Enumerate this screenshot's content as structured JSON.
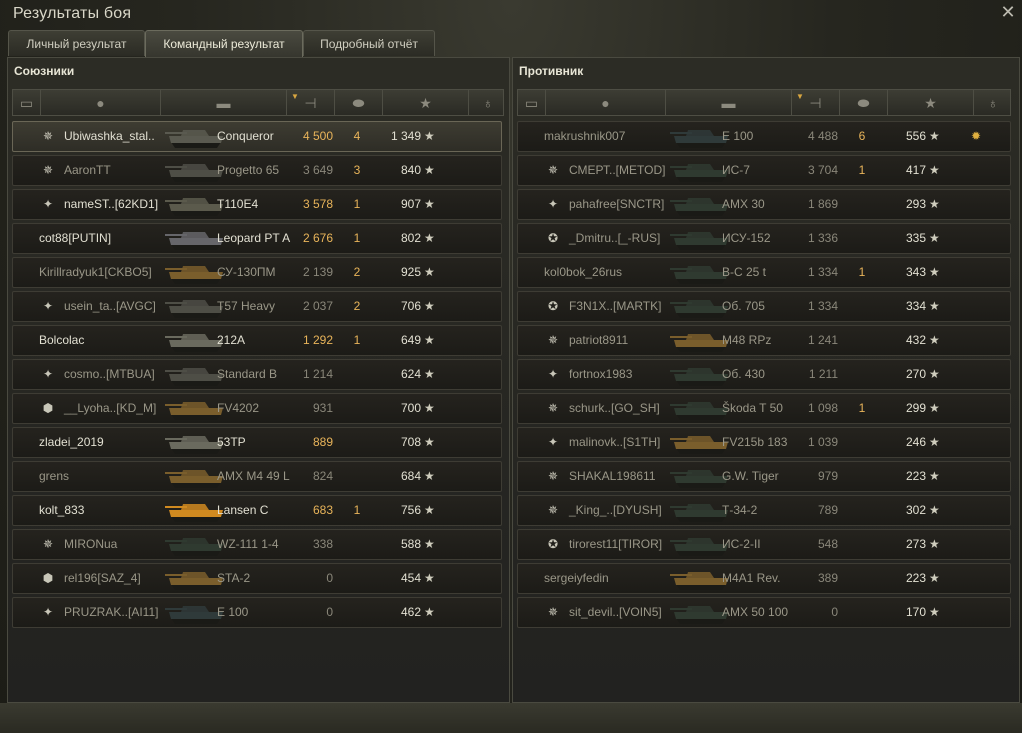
{
  "window": {
    "title": "Результаты боя",
    "close_icon": "close-icon"
  },
  "tabs": [
    {
      "label": "Личный результат",
      "active": false
    },
    {
      "label": "Командный результат",
      "active": true
    },
    {
      "label": "Подробный отчёт",
      "active": false
    }
  ],
  "colors": {
    "gold": "#e8b45a",
    "highlight_row": "#3e3c32"
  },
  "allies": {
    "title": "Союзники",
    "header_icons": [
      "squad-icon",
      "player-icon",
      "tank-icon",
      "damage-icon",
      "kills-icon",
      "xp-star-icon",
      "medal-icon"
    ],
    "rows": [
      {
        "badge": "✵",
        "badge_icon": "clan-emblem-icon",
        "player": "Ubiwashka_stal..",
        "tank": "Conqueror",
        "damage": "4 500",
        "dmg_style": "gold",
        "kills": "4",
        "xp": "1 349",
        "highlight": true,
        "tank_color": "#5a5a50",
        "medal": ""
      },
      {
        "badge": "✵",
        "badge_icon": "clan-emblem-icon",
        "player": "AaronTT",
        "tank": "Progetto 65",
        "damage": "3 649",
        "dmg_style": "grey",
        "kills": "3",
        "xp": "840",
        "player_style": "dim",
        "tank_style": "dim",
        "tank_color": "#4e4e46",
        "medal": ""
      },
      {
        "badge": "✦",
        "badge_icon": "clan-emblem-icon",
        "player": "nameST..[62KD1]",
        "tank": "T110E4",
        "damage": "3 578",
        "dmg_style": "gold",
        "kills": "1",
        "xp": "907",
        "tank_color": "#5b5a4c",
        "medal": ""
      },
      {
        "badge": "",
        "badge_icon": "",
        "player": "cot88[PUTIN]",
        "tank": "Leopard PT A",
        "damage": "2 676",
        "dmg_style": "gold",
        "kills": "1",
        "xp": "802",
        "tank_color": "#66666a",
        "medal": ""
      },
      {
        "badge": "",
        "badge_icon": "",
        "player": "Kirillradyuk1[CKBO5]",
        "tank": "СУ-130ПМ",
        "damage": "2 139",
        "dmg_style": "grey",
        "kills": "2",
        "xp": "925",
        "player_style": "dim",
        "tank_style": "dim",
        "tank_color": "#7a5e2c",
        "medal": ""
      },
      {
        "badge": "✦",
        "badge_icon": "clan-emblem-icon",
        "player": "usein_ta..[AVGC]",
        "tank": "T57 Heavy",
        "damage": "2 037",
        "dmg_style": "grey",
        "kills": "2",
        "xp": "706",
        "player_style": "dim",
        "tank_style": "dim",
        "tank_color": "#4e4e46",
        "medal": ""
      },
      {
        "badge": "",
        "badge_icon": "",
        "player": "Bolcolac",
        "tank": "212A",
        "damage": "1 292",
        "dmg_style": "gold",
        "kills": "1",
        "xp": "649",
        "tank_color": "#6a6a5e",
        "medal": ""
      },
      {
        "badge": "✦",
        "badge_icon": "clan-emblem-icon",
        "player": "cosmo..[MTBUA]",
        "tank": "Standard B",
        "damage": "1 214",
        "dmg_style": "grey",
        "kills": "",
        "xp": "624",
        "player_style": "dim",
        "tank_style": "dim",
        "tank_color": "#4e4e46",
        "medal": ""
      },
      {
        "badge": "⬢",
        "badge_icon": "clan-emblem-icon",
        "player": "__Lyoha..[KD_M]",
        "tank": "FV4202",
        "damage": "931",
        "dmg_style": "grey",
        "kills": "",
        "xp": "700",
        "player_style": "dim",
        "tank_style": "dim",
        "tank_color": "#7a5e2c",
        "medal": ""
      },
      {
        "badge": "",
        "badge_icon": "",
        "player": "zladei_2019",
        "tank": "53TP",
        "damage": "889",
        "dmg_style": "gold",
        "kills": "",
        "xp": "708",
        "tank_color": "#6a6a5e",
        "medal": ""
      },
      {
        "badge": "",
        "badge_icon": "",
        "player": "grens",
        "tank": "AMX M4 49 L",
        "damage": "824",
        "dmg_style": "grey",
        "kills": "",
        "xp": "684",
        "player_style": "dim",
        "tank_style": "dim",
        "tank_color": "#7a5e2c",
        "medal": ""
      },
      {
        "badge": "",
        "badge_icon": "",
        "player": "kolt_833",
        "tank": "Lansen C",
        "damage": "683",
        "dmg_style": "gold",
        "kills": "1",
        "xp": "756",
        "tank_color": "#d08a20",
        "medal": ""
      },
      {
        "badge": "✵",
        "badge_icon": "clan-emblem-icon",
        "player": "MIRONua",
        "tank": "WZ-111 1-4",
        "damage": "338",
        "dmg_style": "grey",
        "kills": "",
        "xp": "588",
        "player_style": "dim",
        "tank_style": "dim",
        "tank_color": "#2f3a30",
        "medal": ""
      },
      {
        "badge": "⬢",
        "badge_icon": "clan-emblem-icon",
        "player": "rel196[SAZ_4]",
        "tank": "STA-2",
        "damage": "0",
        "dmg_style": "grey",
        "kills": "",
        "xp": "454",
        "player_style": "dim",
        "tank_style": "dim",
        "tank_color": "#7a5e2c",
        "medal": ""
      },
      {
        "badge": "✦",
        "badge_icon": "clan-emblem-icon",
        "player": "PRUZRAK..[AI11]",
        "tank": "E 100",
        "damage": "0",
        "dmg_style": "grey",
        "kills": "",
        "xp": "462",
        "player_style": "dim",
        "tank_style": "dim",
        "tank_color": "#2f3a3a",
        "medal": ""
      }
    ]
  },
  "enemies": {
    "title": "Противник",
    "header_icons": [
      "squad-icon",
      "player-icon",
      "tank-icon",
      "damage-icon",
      "kills-icon",
      "xp-star-icon",
      "medal-icon"
    ],
    "rows": [
      {
        "badge": "",
        "badge_icon": "",
        "player": "makrushnik007",
        "tank": "E 100",
        "damage": "4 488",
        "dmg_style": "grey",
        "kills": "6",
        "xp": "556",
        "player_style": "dim",
        "tank_style": "dim",
        "tank_color": "#2f3a3a",
        "medal": "✹"
      },
      {
        "badge": "✵",
        "badge_icon": "clan-emblem-icon",
        "player": "СМЕРТ..[METOD]",
        "tank": "ИС-7",
        "damage": "3 704",
        "dmg_style": "grey",
        "kills": "1",
        "xp": "417",
        "player_style": "dim",
        "tank_style": "dim",
        "tank_color": "#2f3a30",
        "medal": ""
      },
      {
        "badge": "✦",
        "badge_icon": "clan-emblem-icon",
        "player": "pahafree[SNCTR]",
        "tank": "AMX 30",
        "damage": "1 869",
        "dmg_style": "grey",
        "kills": "",
        "xp": "293",
        "player_style": "dim",
        "tank_style": "dim",
        "tank_color": "#2f3a30",
        "medal": ""
      },
      {
        "badge": "✪",
        "badge_icon": "clan-emblem-icon",
        "player": "_Dmitru..[_-RUS]",
        "tank": "ИСУ-152",
        "damage": "1 336",
        "dmg_style": "grey",
        "kills": "",
        "xp": "335",
        "player_style": "dim",
        "tank_style": "dim",
        "tank_color": "#2f3a30",
        "medal": ""
      },
      {
        "badge": "",
        "badge_icon": "",
        "player": "kol0bok_26rus",
        "tank": "В-С 25 t",
        "damage": "1 334",
        "dmg_style": "grey",
        "kills": "1",
        "xp": "343",
        "player_style": "dim",
        "tank_style": "dim",
        "tank_color": "#2f3a30",
        "medal": ""
      },
      {
        "badge": "✪",
        "badge_icon": "clan-emblem-icon",
        "player": "F3N1X..[MARTK]",
        "tank": "Об. 705",
        "damage": "1 334",
        "dmg_style": "grey",
        "kills": "",
        "xp": "334",
        "player_style": "dim",
        "tank_style": "dim",
        "tank_color": "#2f3a30",
        "medal": ""
      },
      {
        "badge": "✵",
        "badge_icon": "clan-emblem-icon",
        "player": "patriot8911",
        "tank": "M48 RPz",
        "damage": "1 241",
        "dmg_style": "grey",
        "kills": "",
        "xp": "432",
        "player_style": "dim",
        "tank_style": "dim",
        "tank_color": "#7a5e2c",
        "medal": ""
      },
      {
        "badge": "✦",
        "badge_icon": "clan-emblem-icon",
        "player": "fortnox1983",
        "tank": "Об. 430",
        "damage": "1 211",
        "dmg_style": "grey",
        "kills": "",
        "xp": "270",
        "player_style": "dim",
        "tank_style": "dim",
        "tank_color": "#2f3a30",
        "medal": ""
      },
      {
        "badge": "✵",
        "badge_icon": "clan-emblem-icon",
        "player": "schurk..[GO_SH]",
        "tank": "Škoda T 50",
        "damage": "1 098",
        "dmg_style": "grey",
        "kills": "1",
        "xp": "299",
        "player_style": "dim",
        "tank_style": "dim",
        "tank_color": "#2f3a30",
        "medal": ""
      },
      {
        "badge": "✦",
        "badge_icon": "clan-emblem-icon",
        "player": "malinovk..[S1TH]",
        "tank": "FV215b 183",
        "damage": "1 039",
        "dmg_style": "grey",
        "kills": "",
        "xp": "246",
        "player_style": "dim",
        "tank_style": "dim",
        "tank_color": "#7a5e2c",
        "medal": ""
      },
      {
        "badge": "✵",
        "badge_icon": "clan-emblem-icon",
        "player": "SHAKAL198611",
        "tank": "G.W. Tiger",
        "damage": "979",
        "dmg_style": "grey",
        "kills": "",
        "xp": "223",
        "player_style": "dim",
        "tank_style": "dim",
        "tank_color": "#2f3a30",
        "medal": ""
      },
      {
        "badge": "✵",
        "badge_icon": "clan-emblem-icon",
        "player": "_King_..[DYUSH]",
        "tank": "Т-34-2",
        "damage": "789",
        "dmg_style": "grey",
        "kills": "",
        "xp": "302",
        "player_style": "dim",
        "tank_style": "dim",
        "tank_color": "#2f3a30",
        "medal": ""
      },
      {
        "badge": "✪",
        "badge_icon": "clan-emblem-icon",
        "player": "tirorest11[TIROR]",
        "tank": "ИС-2-II",
        "damage": "548",
        "dmg_style": "grey",
        "kills": "",
        "xp": "273",
        "player_style": "dim",
        "tank_style": "dim",
        "tank_color": "#2f3a30",
        "medal": ""
      },
      {
        "badge": "",
        "badge_icon": "",
        "player": "sergeiyfedin",
        "tank": "M4A1 Rev.",
        "damage": "389",
        "dmg_style": "grey",
        "kills": "",
        "xp": "223",
        "player_style": "dim",
        "tank_style": "dim",
        "tank_color": "#7a5e2c",
        "medal": ""
      },
      {
        "badge": "✵",
        "badge_icon": "clan-emblem-icon",
        "player": "sit_devil..[VOIN5]",
        "tank": "AMX 50 100",
        "damage": "0",
        "dmg_style": "grey",
        "kills": "",
        "xp": "170",
        "player_style": "dim",
        "tank_style": "dim",
        "tank_color": "#2f3a30",
        "medal": ""
      }
    ]
  }
}
